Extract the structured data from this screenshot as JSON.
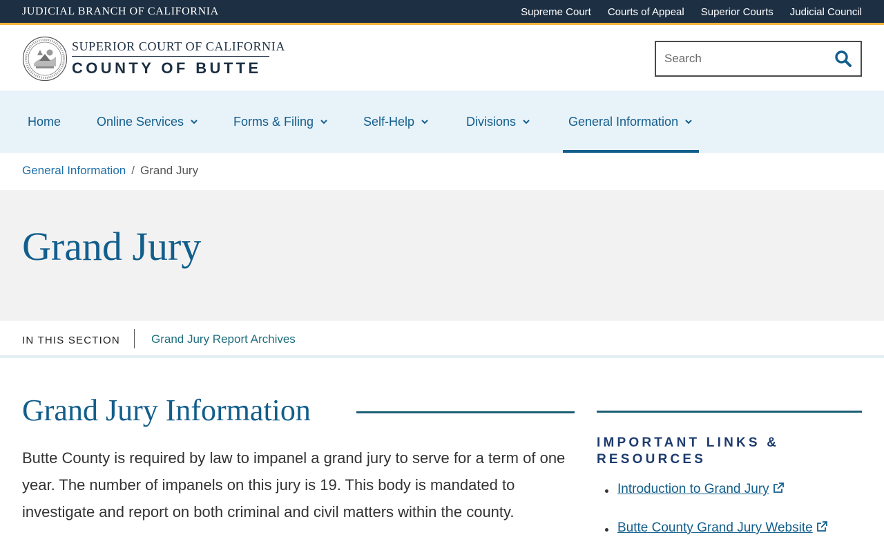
{
  "topbar": {
    "brand": "JUDICIAL BRANCH OF CALIFORNIA",
    "links": [
      "Supreme Court",
      "Courts of Appeal",
      "Superior Courts",
      "Judicial Council"
    ]
  },
  "header": {
    "court_line1": "SUPERIOR COURT OF CALIFORNIA",
    "court_line2": "COUNTY OF BUTTE",
    "logo_icon": "california-judicial-seal-icon",
    "search_placeholder": "Search",
    "search_icon": "search-icon"
  },
  "nav": {
    "items": [
      {
        "label": "Home",
        "dropdown": false
      },
      {
        "label": "Online Services",
        "dropdown": true
      },
      {
        "label": "Forms & Filing",
        "dropdown": true
      },
      {
        "label": "Self-Help",
        "dropdown": true
      },
      {
        "label": "Divisions",
        "dropdown": true
      },
      {
        "label": "General Information",
        "dropdown": true,
        "active": true
      }
    ]
  },
  "breadcrumb": {
    "parent": "General Information",
    "separator": "/",
    "current": "Grand Jury"
  },
  "hero": {
    "title": "Grand Jury"
  },
  "section": {
    "label": "IN THIS SECTION",
    "link": "Grand Jury Report Archives"
  },
  "main": {
    "heading": "Grand Jury Information",
    "paragraph": "Butte County is required by law to impanel a grand jury to serve for a term of one year. The number of impanels on this jury is 19. This body is mandated to investigate and report on both criminal and civil matters within the county."
  },
  "aside": {
    "heading": "IMPORTANT LINKS & RESOURCES",
    "links": [
      "Introduction to Grand Jury",
      "Butte County Grand Jury Website"
    ]
  },
  "colors": {
    "topbar": "#1d2f42",
    "accent_gold": "#f3b43a",
    "brand_blue": "#125e8c",
    "nav_bg": "#e8f2f9",
    "teal_rule": "#1a5f73"
  }
}
